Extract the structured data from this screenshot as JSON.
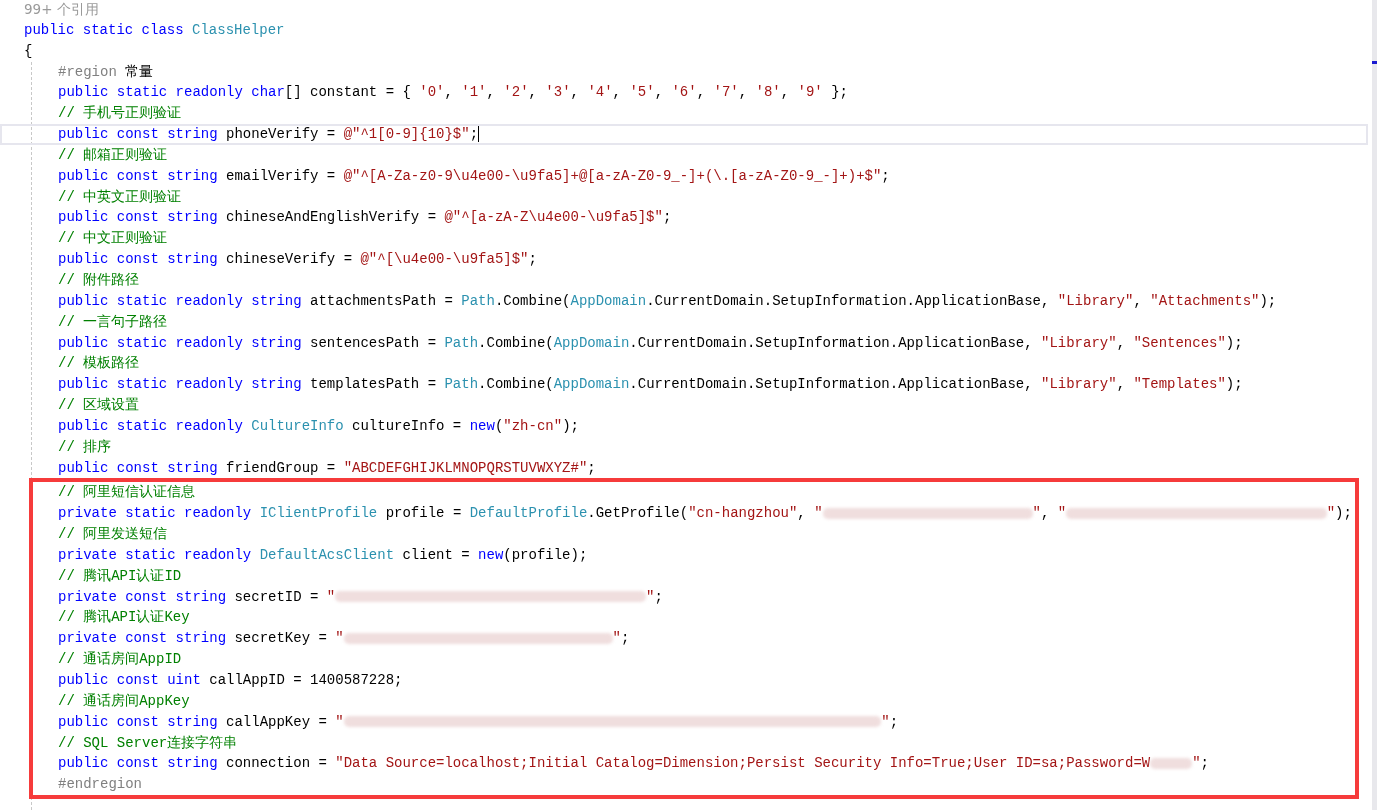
{
  "editor": {
    "reference_count": "99+ 个引用",
    "declaration": [
      {
        "kind": "kw",
        "text": "public static class "
      },
      {
        "kind": "type",
        "text": "ClassHelper"
      }
    ],
    "open_brace": "{",
    "body": [
      {
        "kind": "plain",
        "lines": [
          {
            "current": false,
            "tokens": [
              {
                "kind": "pre",
                "text": "#region "
              },
              {
                "kind": "plain",
                "text": "常量"
              }
            ]
          },
          {
            "current": false,
            "tokens": [
              {
                "kind": "kw",
                "text": "public static readonly char"
              },
              {
                "kind": "plain",
                "text": "[] constant = { "
              },
              {
                "kind": "str",
                "text": "'0'"
              },
              {
                "kind": "plain",
                "text": ", "
              },
              {
                "kind": "str",
                "text": "'1'"
              },
              {
                "kind": "plain",
                "text": ", "
              },
              {
                "kind": "str",
                "text": "'2'"
              },
              {
                "kind": "plain",
                "text": ", "
              },
              {
                "kind": "str",
                "text": "'3'"
              },
              {
                "kind": "plain",
                "text": ", "
              },
              {
                "kind": "str",
                "text": "'4'"
              },
              {
                "kind": "plain",
                "text": ", "
              },
              {
                "kind": "str",
                "text": "'5'"
              },
              {
                "kind": "plain",
                "text": ", "
              },
              {
                "kind": "str",
                "text": "'6'"
              },
              {
                "kind": "plain",
                "text": ", "
              },
              {
                "kind": "str",
                "text": "'7'"
              },
              {
                "kind": "plain",
                "text": ", "
              },
              {
                "kind": "str",
                "text": "'8'"
              },
              {
                "kind": "plain",
                "text": ", "
              },
              {
                "kind": "str",
                "text": "'9'"
              },
              {
                "kind": "plain",
                "text": " };"
              }
            ]
          },
          {
            "current": false,
            "tokens": [
              {
                "kind": "cmt",
                "text": "// 手机号正则验证"
              }
            ]
          },
          {
            "current": true,
            "tokens": [
              {
                "kind": "kw",
                "text": "public const string "
              },
              {
                "kind": "plain",
                "text": "phoneVerify = "
              },
              {
                "kind": "str",
                "text": "@\"^1[0-9]{10}$\""
              },
              {
                "kind": "plain",
                "text": ";"
              }
            ]
          },
          {
            "current": false,
            "tokens": [
              {
                "kind": "cmt",
                "text": "// 邮箱正则验证"
              }
            ]
          },
          {
            "current": false,
            "tokens": [
              {
                "kind": "kw",
                "text": "public const string "
              },
              {
                "kind": "plain",
                "text": "emailVerify = "
              },
              {
                "kind": "str",
                "text": "@\"^[A-Za-z0-9\\u4e00-\\u9fa5]+@[a-zA-Z0-9_-]+(\\.[a-zA-Z0-9_-]+)+$\""
              },
              {
                "kind": "plain",
                "text": ";"
              }
            ]
          },
          {
            "current": false,
            "tokens": [
              {
                "kind": "cmt",
                "text": "// 中英文正则验证"
              }
            ]
          },
          {
            "current": false,
            "tokens": [
              {
                "kind": "kw",
                "text": "public const string "
              },
              {
                "kind": "plain",
                "text": "chineseAndEnglishVerify = "
              },
              {
                "kind": "str",
                "text": "@\"^[a-zA-Z\\u4e00-\\u9fa5]$\""
              },
              {
                "kind": "plain",
                "text": ";"
              }
            ]
          },
          {
            "current": false,
            "tokens": [
              {
                "kind": "cmt",
                "text": "// 中文正则验证"
              }
            ]
          },
          {
            "current": false,
            "tokens": [
              {
                "kind": "kw",
                "text": "public const string "
              },
              {
                "kind": "plain",
                "text": "chineseVerify = "
              },
              {
                "kind": "str",
                "text": "@\"^[\\u4e00-\\u9fa5]$\""
              },
              {
                "kind": "plain",
                "text": ";"
              }
            ]
          },
          {
            "current": false,
            "tokens": [
              {
                "kind": "cmt",
                "text": "// 附件路径"
              }
            ]
          },
          {
            "current": false,
            "tokens": [
              {
                "kind": "kw",
                "text": "public static readonly string "
              },
              {
                "kind": "plain",
                "text": "attachmentsPath = "
              },
              {
                "kind": "type",
                "text": "Path"
              },
              {
                "kind": "plain",
                "text": ".Combine("
              },
              {
                "kind": "type",
                "text": "AppDomain"
              },
              {
                "kind": "plain",
                "text": ".CurrentDomain.SetupInformation.ApplicationBase, "
              },
              {
                "kind": "str",
                "text": "\"Library\""
              },
              {
                "kind": "plain",
                "text": ", "
              },
              {
                "kind": "str",
                "text": "\"Attachments\""
              },
              {
                "kind": "plain",
                "text": ");"
              }
            ]
          },
          {
            "current": false,
            "tokens": [
              {
                "kind": "cmt",
                "text": "// 一言句子路径"
              }
            ]
          },
          {
            "current": false,
            "tokens": [
              {
                "kind": "kw",
                "text": "public static readonly string "
              },
              {
                "kind": "plain",
                "text": "sentencesPath = "
              },
              {
                "kind": "type",
                "text": "Path"
              },
              {
                "kind": "plain",
                "text": ".Combine("
              },
              {
                "kind": "type",
                "text": "AppDomain"
              },
              {
                "kind": "plain",
                "text": ".CurrentDomain.SetupInformation.ApplicationBase, "
              },
              {
                "kind": "str",
                "text": "\"Library\""
              },
              {
                "kind": "plain",
                "text": ", "
              },
              {
                "kind": "str",
                "text": "\"Sentences\""
              },
              {
                "kind": "plain",
                "text": ");"
              }
            ]
          },
          {
            "current": false,
            "tokens": [
              {
                "kind": "cmt",
                "text": "// 模板路径"
              }
            ]
          },
          {
            "current": false,
            "tokens": [
              {
                "kind": "kw",
                "text": "public static readonly string "
              },
              {
                "kind": "plain",
                "text": "templatesPath = "
              },
              {
                "kind": "type",
                "text": "Path"
              },
              {
                "kind": "plain",
                "text": ".Combine("
              },
              {
                "kind": "type",
                "text": "AppDomain"
              },
              {
                "kind": "plain",
                "text": ".CurrentDomain.SetupInformation.ApplicationBase, "
              },
              {
                "kind": "str",
                "text": "\"Library\""
              },
              {
                "kind": "plain",
                "text": ", "
              },
              {
                "kind": "str",
                "text": "\"Templates\""
              },
              {
                "kind": "plain",
                "text": ");"
              }
            ]
          },
          {
            "current": false,
            "tokens": [
              {
                "kind": "cmt",
                "text": "// 区域设置"
              }
            ]
          },
          {
            "current": false,
            "tokens": [
              {
                "kind": "kw",
                "text": "public static readonly "
              },
              {
                "kind": "type",
                "text": "CultureInfo"
              },
              {
                "kind": "plain",
                "text": " cultureInfo = "
              },
              {
                "kind": "kw",
                "text": "new"
              },
              {
                "kind": "plain",
                "text": "("
              },
              {
                "kind": "str",
                "text": "\"zh-cn\""
              },
              {
                "kind": "plain",
                "text": ");"
              }
            ]
          },
          {
            "current": false,
            "tokens": [
              {
                "kind": "cmt",
                "text": "// 排序"
              }
            ]
          },
          {
            "current": false,
            "tokens": [
              {
                "kind": "kw",
                "text": "public const string "
              },
              {
                "kind": "plain",
                "text": "friendGroup = "
              },
              {
                "kind": "str",
                "text": "\"ABCDEFGHIJKLMNOPQRSTUVWXYZ#\""
              },
              {
                "kind": "plain",
                "text": ";"
              }
            ]
          }
        ]
      },
      {
        "kind": "highlighted",
        "lines": [
          {
            "current": false,
            "tokens": [
              {
                "kind": "cmt",
                "text": "// 阿里短信认证信息"
              }
            ]
          },
          {
            "current": false,
            "tokens": [
              {
                "kind": "kw",
                "text": "private static readonly "
              },
              {
                "kind": "type",
                "text": "IClientProfile"
              },
              {
                "kind": "plain",
                "text": " profile = "
              },
              {
                "kind": "type",
                "text": "DefaultProfile"
              },
              {
                "kind": "plain",
                "text": ".GetProfile("
              },
              {
                "kind": "str",
                "text": "\"cn-hangzhou\""
              },
              {
                "kind": "plain",
                "text": ", "
              },
              {
                "kind": "str",
                "text": "\""
              },
              {
                "kind": "redacted"
              },
              {
                "kind": "str",
                "text": "\""
              },
              {
                "kind": "plain",
                "text": ", "
              },
              {
                "kind": "str",
                "text": "\""
              },
              {
                "kind": "redacted"
              },
              {
                "kind": "str",
                "text": "\""
              },
              {
                "kind": "plain",
                "text": ");"
              }
            ]
          },
          {
            "current": false,
            "tokens": [
              {
                "kind": "cmt",
                "text": "// 阿里发送短信"
              }
            ]
          },
          {
            "current": false,
            "tokens": [
              {
                "kind": "kw",
                "text": "private static readonly "
              },
              {
                "kind": "type",
                "text": "DefaultAcsClient"
              },
              {
                "kind": "plain",
                "text": " client = "
              },
              {
                "kind": "kw",
                "text": "new"
              },
              {
                "kind": "plain",
                "text": "(profile);"
              }
            ]
          },
          {
            "current": false,
            "tokens": [
              {
                "kind": "cmt",
                "text": "// 腾讯API认证ID"
              }
            ]
          },
          {
            "current": false,
            "tokens": [
              {
                "kind": "kw",
                "text": "private const string "
              },
              {
                "kind": "plain",
                "text": "secretID = "
              },
              {
                "kind": "str",
                "text": "\""
              },
              {
                "kind": "redacted"
              },
              {
                "kind": "str",
                "text": "\""
              },
              {
                "kind": "plain",
                "text": ";"
              }
            ]
          },
          {
            "current": false,
            "tokens": [
              {
                "kind": "cmt",
                "text": "// 腾讯API认证Key"
              }
            ]
          },
          {
            "current": false,
            "tokens": [
              {
                "kind": "kw",
                "text": "private const string "
              },
              {
                "kind": "plain",
                "text": "secretKey = "
              },
              {
                "kind": "str",
                "text": "\""
              },
              {
                "kind": "redacted"
              },
              {
                "kind": "str",
                "text": "\""
              },
              {
                "kind": "plain",
                "text": ";"
              }
            ]
          },
          {
            "current": false,
            "tokens": [
              {
                "kind": "cmt",
                "text": "// 通话房间AppID"
              }
            ]
          },
          {
            "current": false,
            "tokens": [
              {
                "kind": "kw",
                "text": "public const uint "
              },
              {
                "kind": "plain",
                "text": "callAppID = 1400587228;"
              }
            ]
          },
          {
            "current": false,
            "tokens": [
              {
                "kind": "cmt",
                "text": "// 通话房间AppKey"
              }
            ]
          },
          {
            "current": false,
            "tokens": [
              {
                "kind": "kw",
                "text": "public const string "
              },
              {
                "kind": "plain",
                "text": "callAppKey = "
              },
              {
                "kind": "str",
                "text": "\""
              },
              {
                "kind": "redacted"
              },
              {
                "kind": "str",
                "text": "\""
              },
              {
                "kind": "plain",
                "text": ";"
              }
            ]
          },
          {
            "current": false,
            "tokens": [
              {
                "kind": "cmt",
                "text": "// SQL Server连接字符串"
              }
            ]
          },
          {
            "current": false,
            "tokens": [
              {
                "kind": "kw",
                "text": "public const string "
              },
              {
                "kind": "plain",
                "text": "connection = "
              },
              {
                "kind": "str",
                "text": "\"Data Source=localhost;Initial Catalog=Dimension;Persist Security Info=True;User ID=sa;Password=W"
              },
              {
                "kind": "redacted"
              },
              {
                "kind": "str",
                "text": "\""
              },
              {
                "kind": "plain",
                "text": ";"
              }
            ]
          },
          {
            "current": false,
            "tokens": [
              {
                "kind": "pre",
                "text": "#endregion"
              }
            ]
          }
        ]
      }
    ]
  }
}
